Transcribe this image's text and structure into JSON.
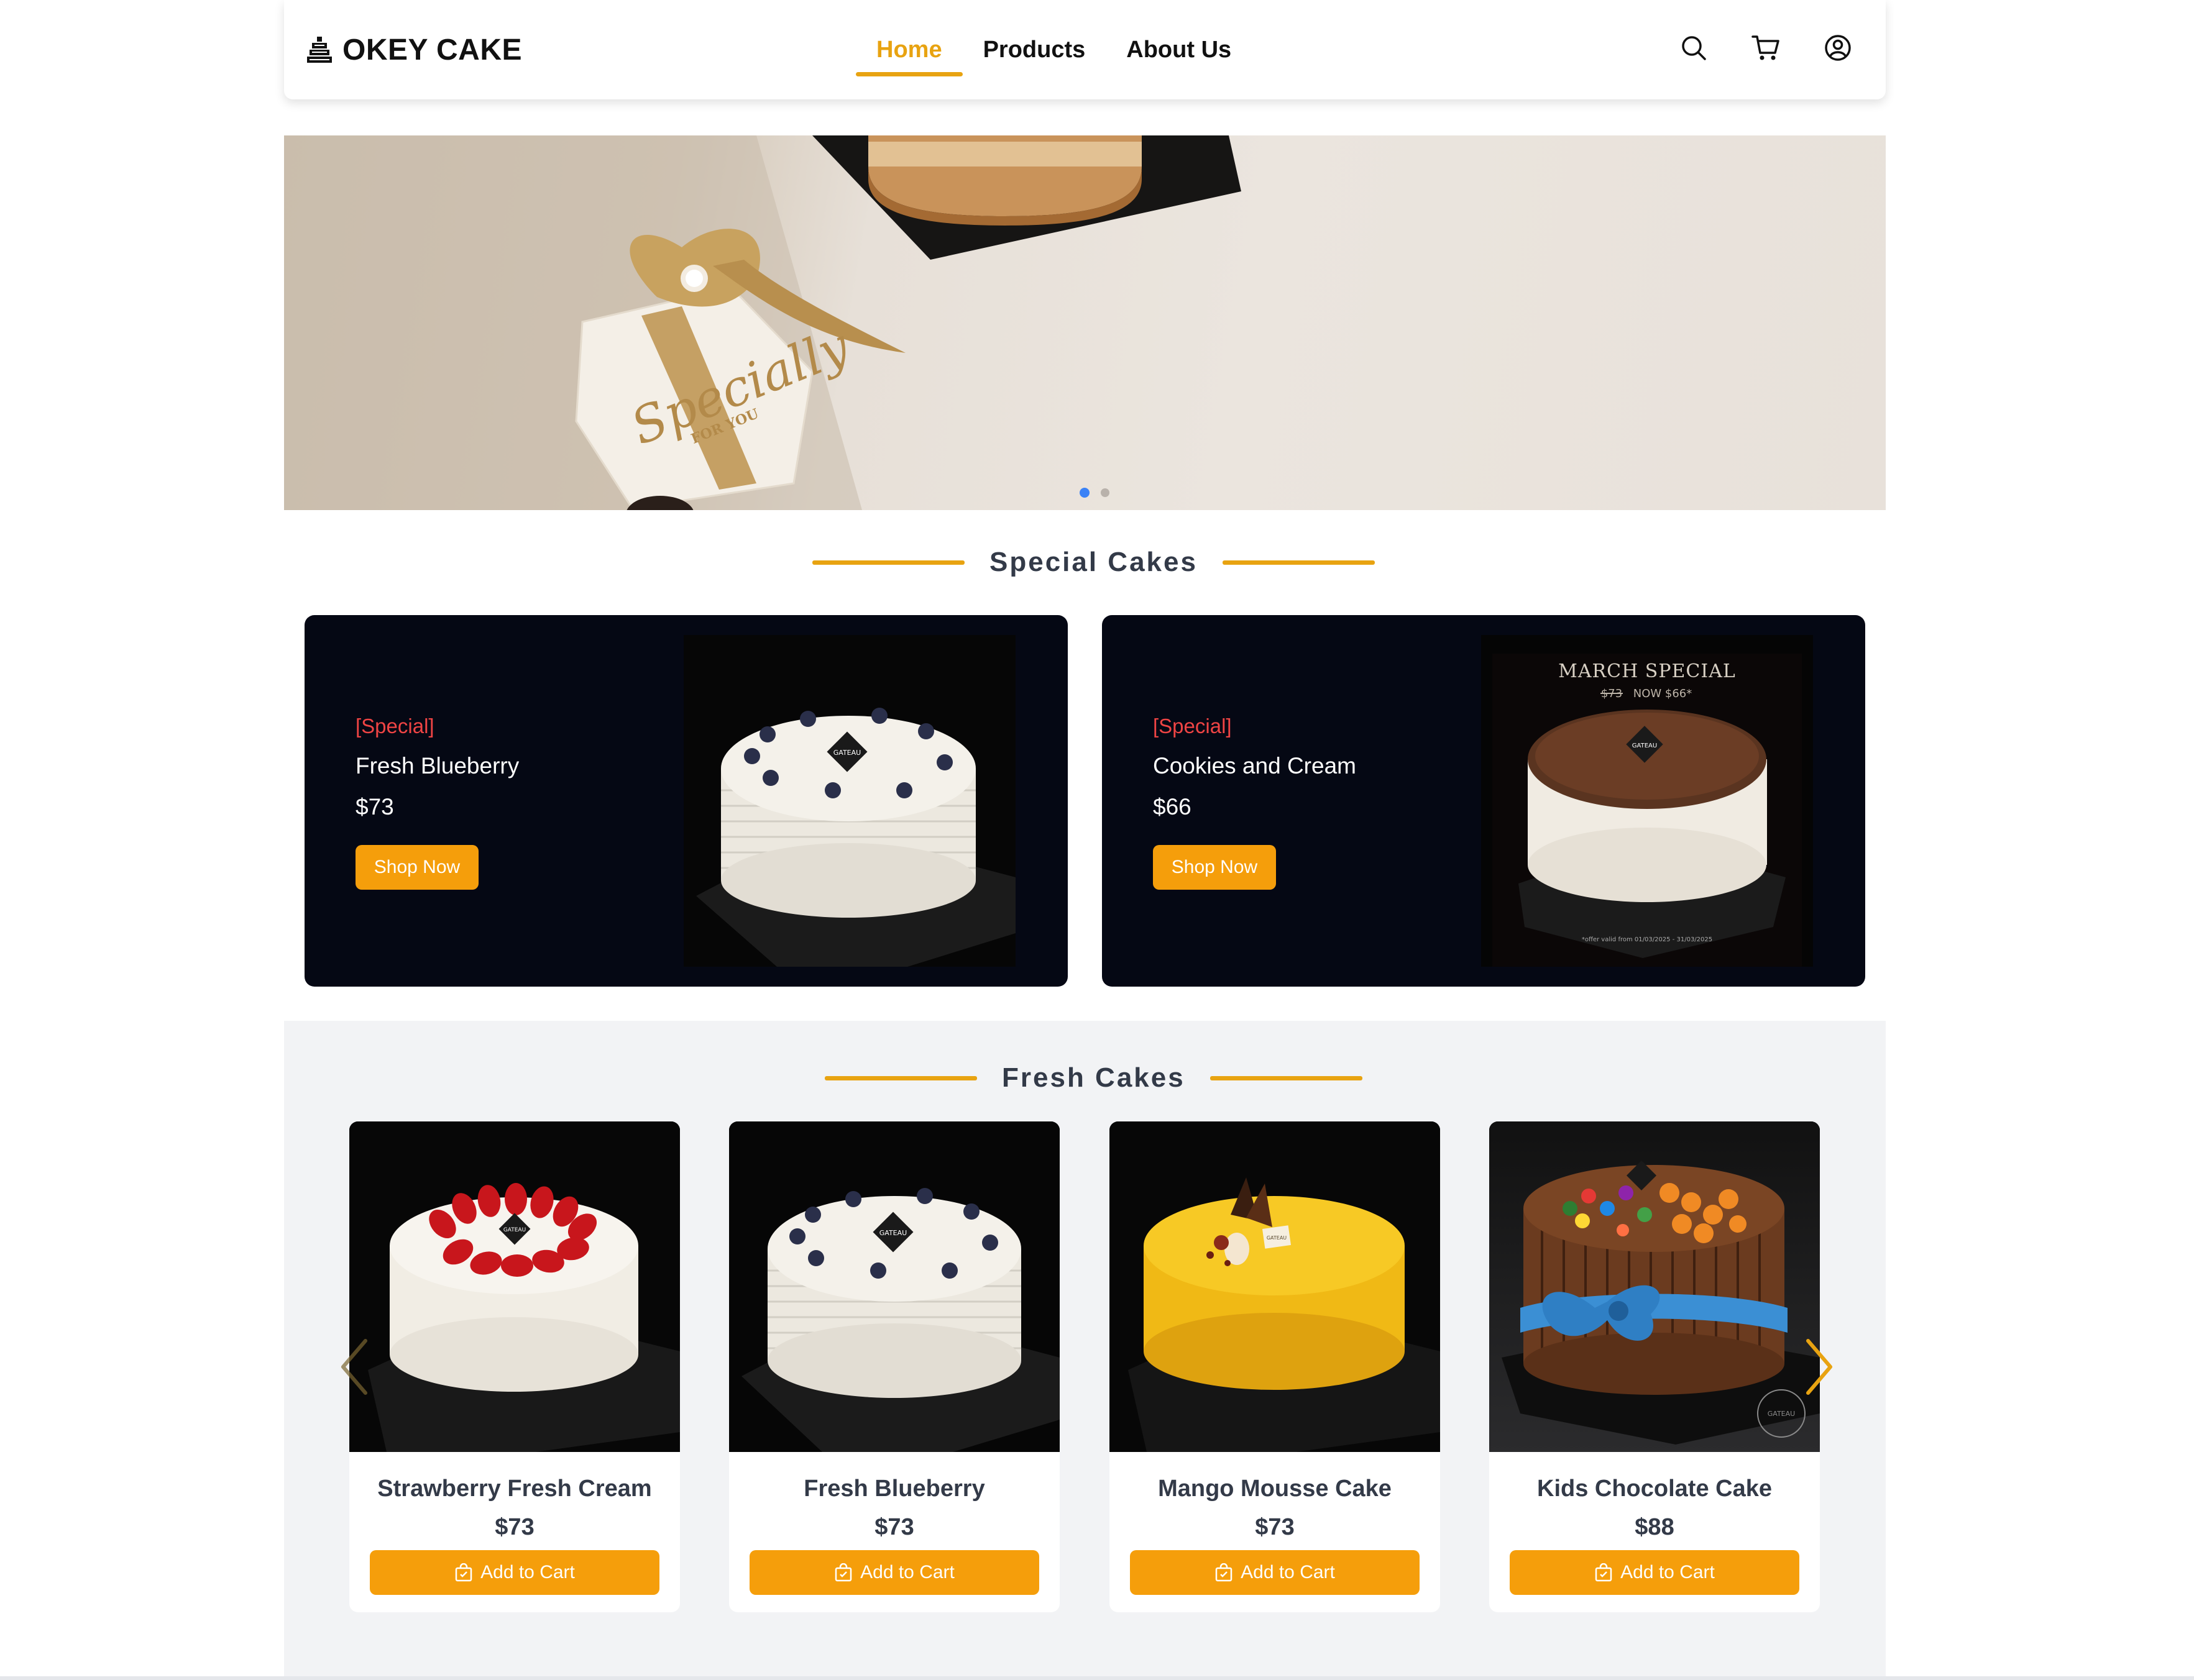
{
  "header": {
    "logo_text": "OKEY CAKE",
    "nav": [
      {
        "label": "Home",
        "active": true
      },
      {
        "label": "Products",
        "active": false
      },
      {
        "label": "About Us",
        "active": false
      }
    ],
    "icons": [
      "search-icon",
      "cart-icon",
      "user-icon"
    ]
  },
  "hero": {
    "box_text_main": "Specially",
    "box_text_sub": "FOR YOU",
    "carousel_slides": 2,
    "active_slide": 1
  },
  "special_section": {
    "title": "Special Cakes",
    "cards": [
      {
        "tag": "[Special]",
        "name": "Fresh Blueberry",
        "price": "$73",
        "button": "Shop Now"
      },
      {
        "tag": "[Special]",
        "name": "Cookies and Cream",
        "price": "$66",
        "button": "Shop Now",
        "promo_title": "MARCH SPECIAL",
        "promo_old_price": "$73",
        "promo_now": "NOW $66*",
        "promo_note": "*offer valid from 01/03/2025 - 31/03/2025"
      }
    ]
  },
  "fresh_section": {
    "title": "Fresh Cakes",
    "cards": [
      {
        "name": "Strawberry Fresh Cream",
        "price": "$73",
        "button": "Add to Cart"
      },
      {
        "name": "Fresh Blueberry",
        "price": "$73",
        "button": "Add to Cart"
      },
      {
        "name": "Mango Mousse Cake",
        "price": "$73",
        "button": "Add to Cart"
      },
      {
        "name": "Kids Chocolate Cake",
        "price": "$88",
        "button": "Add to Cart"
      }
    ]
  },
  "cake_badge_text": "GATEAU",
  "colors": {
    "accent": "#e8a311",
    "button": "#f59e0b",
    "special_tag": "#ef4444",
    "dark_card": "#050814",
    "carousel_active": "#3b82f6"
  }
}
